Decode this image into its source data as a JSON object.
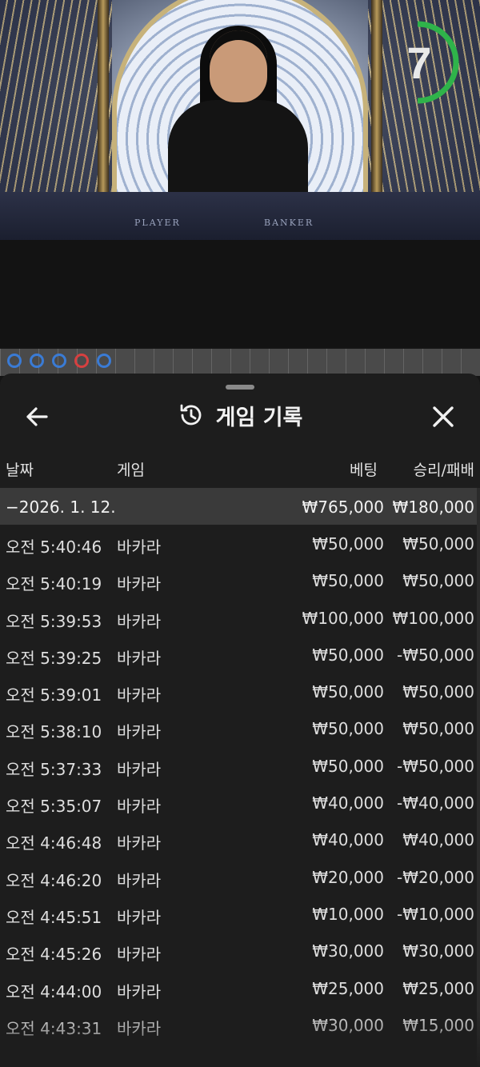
{
  "video": {
    "table_labels": [
      "PLAYER",
      "BANKER"
    ],
    "timer": {
      "value": "7",
      "color": "#2fb34a"
    }
  },
  "road": {
    "circles": [
      {
        "color": "#3a7bd5"
      },
      {
        "color": "#3a7bd5"
      },
      {
        "color": "#3a7bd5"
      },
      {
        "color": "#d64040"
      },
      {
        "color": "#3a7bd5"
      }
    ]
  },
  "modal": {
    "title": "게임 기록",
    "back_icon": "arrow-left-icon",
    "history_icon": "history-clock-icon",
    "close_icon": "close-icon",
    "columns": {
      "date": "날짜",
      "game": "게임",
      "bet": "베팅",
      "winloss": "승리/패배"
    },
    "summary": {
      "date": "−2026. 1. 12.",
      "bet": "₩765,000",
      "winloss": "₩180,000"
    },
    "rows": [
      {
        "time": "오전 5:40:46",
        "game": "바카라",
        "bet": "₩50,000",
        "winloss": "₩50,000"
      },
      {
        "time": "오전 5:40:19",
        "game": "바카라",
        "bet": "₩50,000",
        "winloss": "₩50,000"
      },
      {
        "time": "오전 5:39:53",
        "game": "바카라",
        "bet": "₩100,000",
        "winloss": "₩100,000"
      },
      {
        "time": "오전 5:39:25",
        "game": "바카라",
        "bet": "₩50,000",
        "winloss": "-₩50,000"
      },
      {
        "time": "오전 5:39:01",
        "game": "바카라",
        "bet": "₩50,000",
        "winloss": "₩50,000"
      },
      {
        "time": "오전 5:38:10",
        "game": "바카라",
        "bet": "₩50,000",
        "winloss": "₩50,000"
      },
      {
        "time": "오전 5:37:33",
        "game": "바카라",
        "bet": "₩50,000",
        "winloss": "-₩50,000"
      },
      {
        "time": "오전 5:35:07",
        "game": "바카라",
        "bet": "₩40,000",
        "winloss": "-₩40,000"
      },
      {
        "time": "오전 4:46:48",
        "game": "바카라",
        "bet": "₩40,000",
        "winloss": "₩40,000"
      },
      {
        "time": "오전 4:46:20",
        "game": "바카라",
        "bet": "₩20,000",
        "winloss": "-₩20,000"
      },
      {
        "time": "오전 4:45:51",
        "game": "바카라",
        "bet": "₩10,000",
        "winloss": "-₩10,000"
      },
      {
        "time": "오전 4:45:26",
        "game": "바카라",
        "bet": "₩30,000",
        "winloss": "₩30,000"
      },
      {
        "time": "오전 4:44:00",
        "game": "바카라",
        "bet": "₩25,000",
        "winloss": "₩25,000"
      },
      {
        "time": "오전 4:43:31",
        "game": "바카라",
        "bet": "₩30,000",
        "winloss": "₩15,000"
      }
    ]
  }
}
